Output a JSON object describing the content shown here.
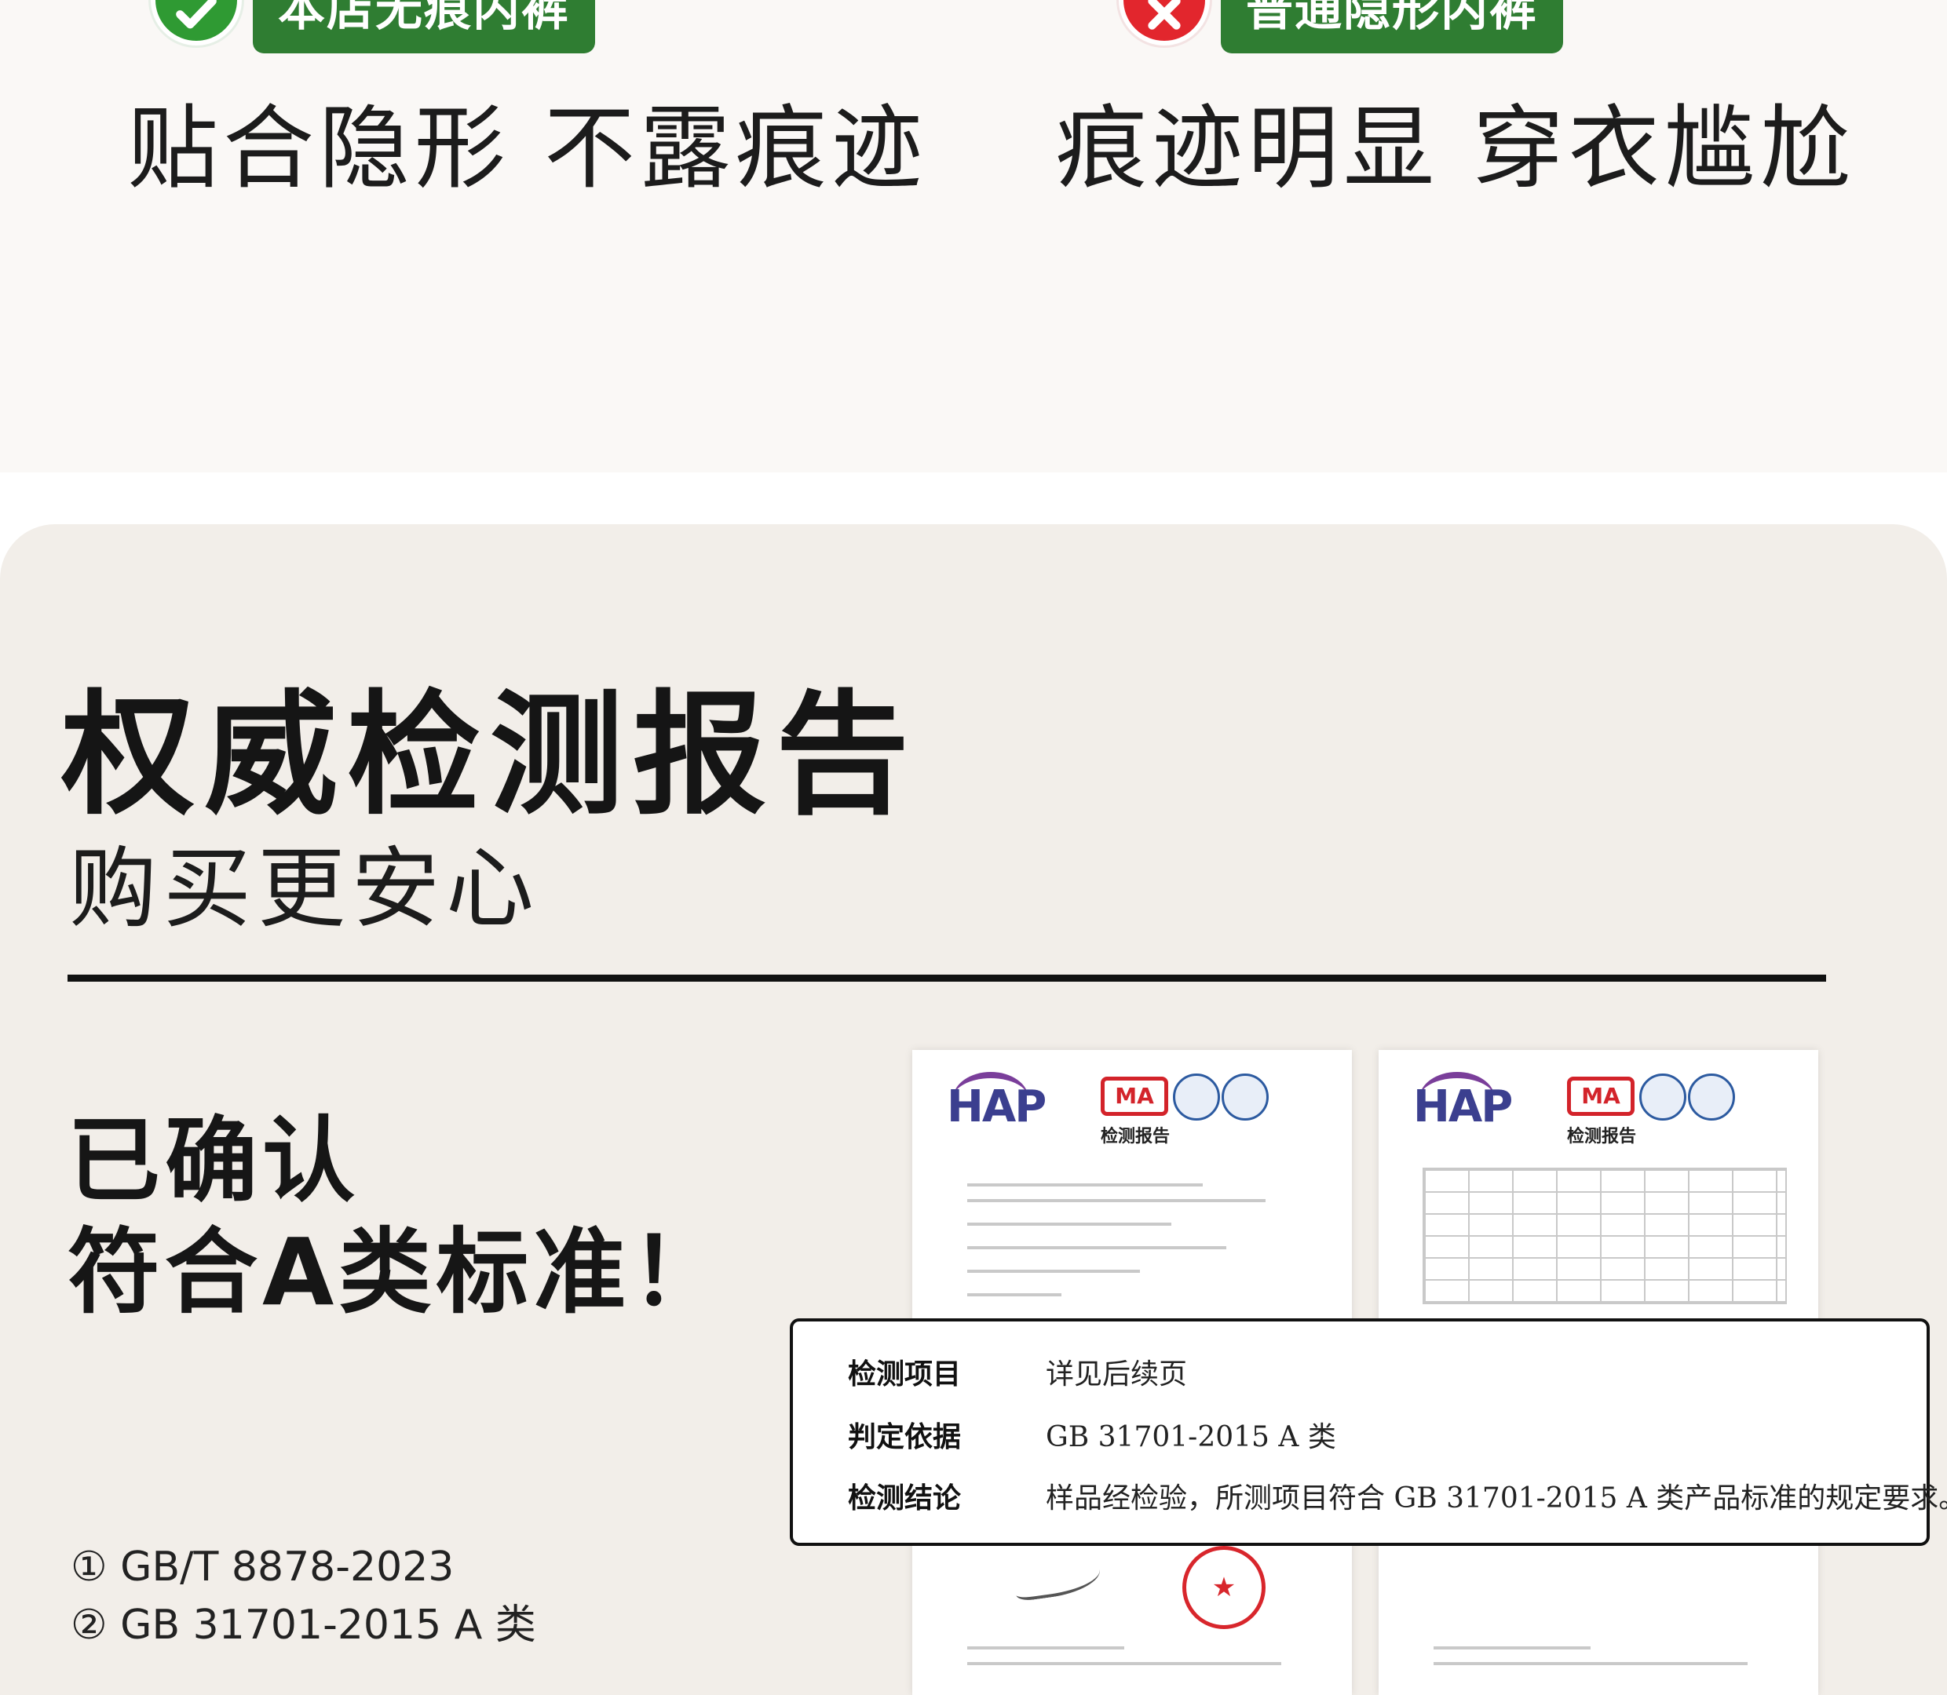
{
  "comparison": {
    "ours": {
      "icon": "check-icon",
      "color": "#2f7d32",
      "tag": "本店无痕内裤",
      "caption": "贴合隐形 不露痕迹"
    },
    "others": {
      "icon": "cross-icon",
      "color": "#e2262d",
      "tag": "普通隐形内裤",
      "caption": "痕迹明显 穿衣尴尬"
    }
  },
  "report": {
    "title": "权威检测报告",
    "subtitle": "购买更安心",
    "confirm_line1": "已确认",
    "confirm_line2": "符合A类标准！",
    "standards": [
      "① GB/T 8878-2023",
      "② GB 31701-2015 A 类"
    ],
    "documents": [
      {
        "logo_text": "HAP",
        "ma_text": "MA",
        "heading": "检测报告"
      },
      {
        "logo_text": "HAP",
        "ma_text": "MA",
        "heading": "检测报告"
      }
    ],
    "result": {
      "rows": [
        {
          "label": "检测项目",
          "value": "详见后续页"
        },
        {
          "label": "判定依据",
          "value": "GB 31701-2015 A 类"
        },
        {
          "label": "检测结论",
          "value": "样品经检验，所测项目符合 GB 31701-2015 A 类产品标准的规定要求。"
        }
      ]
    }
  }
}
